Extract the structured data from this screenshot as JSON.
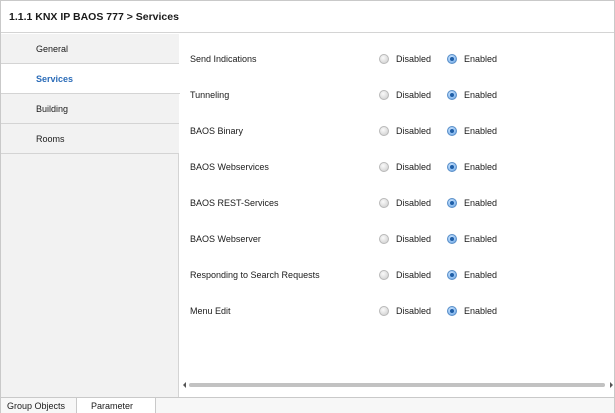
{
  "window": {
    "title": "1.1.1 KNX IP BAOS 777 > Services"
  },
  "sidebar": {
    "items": [
      {
        "label": "General",
        "active": false
      },
      {
        "label": "Services",
        "active": true
      },
      {
        "label": "Building",
        "active": false
      },
      {
        "label": "Rooms",
        "active": false
      }
    ]
  },
  "services": {
    "rows": [
      {
        "label": "Send Indications",
        "disabled_label": "Disabled",
        "enabled_label": "Enabled",
        "selected": "Enabled"
      },
      {
        "label": "Tunneling",
        "disabled_label": "Disabled",
        "enabled_label": "Enabled",
        "selected": "Enabled"
      },
      {
        "label": "BAOS Binary",
        "disabled_label": "Disabled",
        "enabled_label": "Enabled",
        "selected": "Enabled"
      },
      {
        "label": "BAOS Webservices",
        "disabled_label": "Disabled",
        "enabled_label": "Enabled",
        "selected": "Enabled"
      },
      {
        "label": "BAOS REST-Services",
        "disabled_label": "Disabled",
        "enabled_label": "Enabled",
        "selected": "Enabled"
      },
      {
        "label": "BAOS Webserver",
        "disabled_label": "Disabled",
        "enabled_label": "Enabled",
        "selected": "Enabled"
      },
      {
        "label": "Responding to Search Requests",
        "disabled_label": "Disabled",
        "enabled_label": "Enabled",
        "selected": "Enabled"
      },
      {
        "label": "Menu Edit",
        "disabled_label": "Disabled",
        "enabled_label": "Enabled",
        "selected": "Enabled"
      }
    ]
  },
  "bottom_tabs": [
    {
      "label": "Group Objects",
      "active": false
    },
    {
      "label": "Parameter",
      "active": true
    }
  ],
  "colors": {
    "accent": "#2b6cb8",
    "radio_selected": "#5c93d1",
    "sidebar_bg": "#f2f2f2"
  },
  "icons": {
    "scroll_left": "scroll-left-arrow-icon",
    "scroll_right": "scroll-right-arrow-icon"
  }
}
